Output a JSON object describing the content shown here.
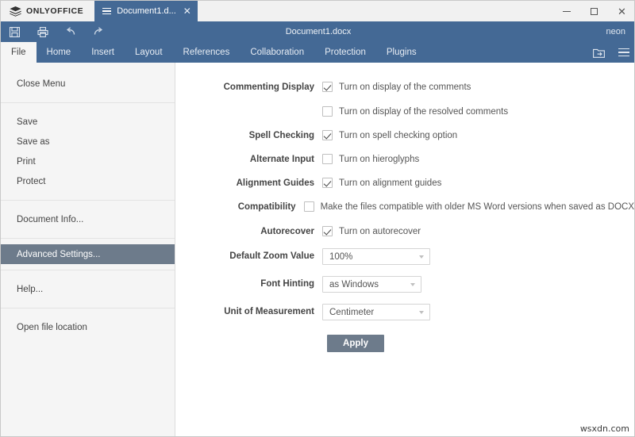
{
  "window": {
    "brand": "ONLYOFFICE",
    "brand_icon": "onlyoffice-logo-icon",
    "tab_title": "Document1.d...",
    "tab_menu_icon": "hamburger-icon",
    "tab_close_icon": "close-icon",
    "minimize_icon": "minimize-icon",
    "maximize_icon": "maximize-icon",
    "close_icon": "close-icon"
  },
  "toolbar": {
    "save_icon": "save-icon",
    "print_icon": "print-icon",
    "undo_icon": "undo-icon",
    "redo_icon": "redo-icon",
    "document_name": "Document1.docx",
    "user_name": "neon"
  },
  "ribbon": {
    "tabs": [
      {
        "label": "File",
        "active": true
      },
      {
        "label": "Home",
        "active": false
      },
      {
        "label": "Insert",
        "active": false
      },
      {
        "label": "Layout",
        "active": false
      },
      {
        "label": "References",
        "active": false
      },
      {
        "label": "Collaboration",
        "active": false
      },
      {
        "label": "Protection",
        "active": false
      },
      {
        "label": "Plugins",
        "active": false
      }
    ],
    "open_location_icon": "open-file-location-icon",
    "view_settings_icon": "hamburger-icon"
  },
  "left_menu": {
    "items": [
      {
        "label": "Close Menu",
        "selected": false
      },
      {
        "label": "Save",
        "selected": false
      },
      {
        "label": "Save as",
        "selected": false
      },
      {
        "label": "Print",
        "selected": false
      },
      {
        "label": "Protect",
        "selected": false
      },
      {
        "label": "Document Info...",
        "selected": false
      },
      {
        "label": "Advanced Settings...",
        "selected": true
      },
      {
        "label": "Help...",
        "selected": false
      },
      {
        "label": "Open file location",
        "selected": false
      }
    ]
  },
  "settings": {
    "rows": [
      {
        "label": "Commenting Display",
        "control": "checkbox",
        "text": "Turn on display of the comments",
        "checked": true
      },
      {
        "label": "",
        "control": "checkbox",
        "text": "Turn on display of the resolved comments",
        "checked": false
      },
      {
        "label": "Spell Checking",
        "control": "checkbox",
        "text": "Turn on spell checking option",
        "checked": true
      },
      {
        "label": "Alternate Input",
        "control": "checkbox",
        "text": "Turn on hieroglyphs",
        "checked": false
      },
      {
        "label": "Alignment Guides",
        "control": "checkbox",
        "text": "Turn on alignment guides",
        "checked": true
      },
      {
        "label": "Compatibility",
        "control": "checkbox",
        "text": "Make the files compatible with older MS Word versions when saved as DOCX",
        "checked": false
      },
      {
        "label": "Autorecover",
        "control": "checkbox",
        "text": "Turn on autorecover",
        "checked": true
      },
      {
        "label": "Default Zoom Value",
        "control": "dropdown",
        "value": "100%"
      },
      {
        "label": "Font Hinting",
        "control": "dropdown",
        "value": "as Windows"
      },
      {
        "label": "Unit of Measurement",
        "control": "dropdown",
        "value": "Centimeter"
      }
    ],
    "apply_label": "Apply"
  },
  "watermark": "wsxdn.com",
  "colors": {
    "accent_blue": "#446995",
    "titlebar": "#f1f1f1",
    "menu_bg": "#f5f5f5",
    "selected": "#6d7b8b"
  }
}
